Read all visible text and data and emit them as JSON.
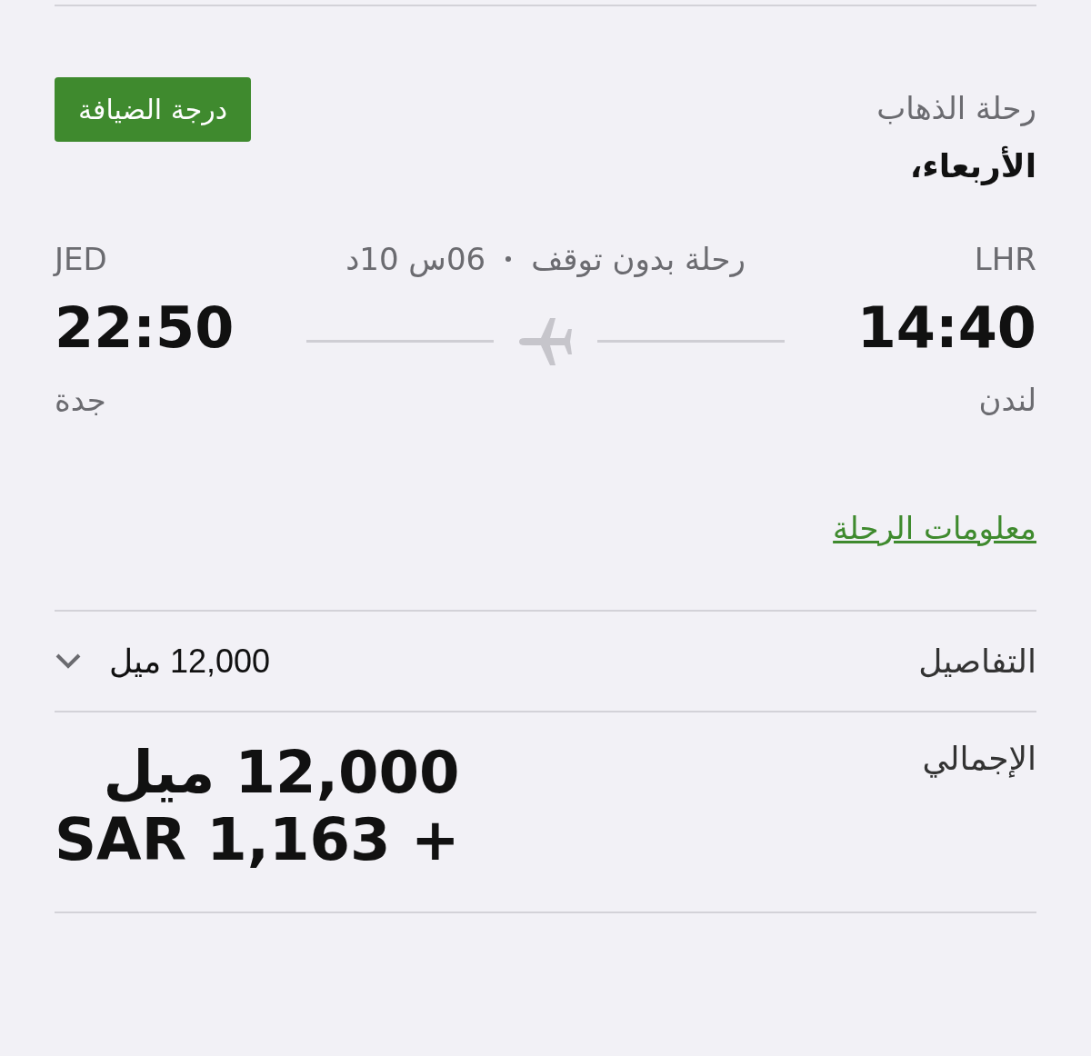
{
  "header": {
    "title": "رحلة الذهاب",
    "day": "الأربعاء،",
    "cabin_badge": "درجة الضيافة"
  },
  "route": {
    "origin": {
      "code": "LHR",
      "time": "14:40",
      "city": "لندن"
    },
    "destination": {
      "code": "JED",
      "time": "22:50",
      "city": "جدة"
    },
    "stops": "رحلة بدون توقف",
    "duration": "06س 10د"
  },
  "flight_info_link": "معلومات الرحلة",
  "details": {
    "label": "التفاصيل",
    "miles": "12,000 ميل",
    "expanded": false
  },
  "total": {
    "label": "الإجمالي",
    "miles": "12,000 ميل",
    "cash": "SAR 1,163 +"
  }
}
